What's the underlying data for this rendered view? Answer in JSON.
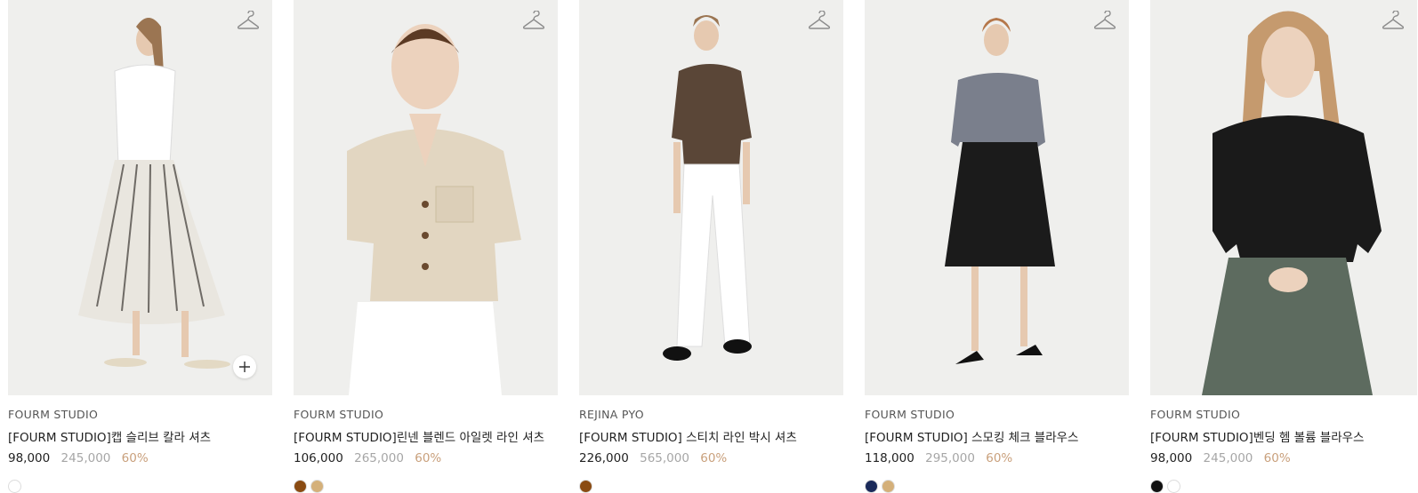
{
  "products": [
    {
      "brand": "FOURM STUDIO",
      "name": "[FOURM STUDIO]캡 슬리브 칼라 셔츠",
      "price": "98,000",
      "original_price": "245,000",
      "discount": "60%",
      "swatches": [
        "#ffffff"
      ]
    },
    {
      "brand": "FOURM STUDIO",
      "name": "[FOURM STUDIO]린넨 블렌드 아일렛 라인 셔츠",
      "price": "106,000",
      "original_price": "265,000",
      "discount": "60%",
      "swatches": [
        "#8a4b12",
        "#d4b07a"
      ]
    },
    {
      "brand": "REJINA PYO",
      "name": "[FOURM STUDIO] 스티치 라인 박시 셔츠",
      "price": "226,000",
      "original_price": "565,000",
      "discount": "60%",
      "swatches": [
        "#8a4b12"
      ]
    },
    {
      "brand": "FOURM STUDIO",
      "name": "[FOURM STUDIO] 스모킹 체크 블라우스",
      "price": "118,000",
      "original_price": "295,000",
      "discount": "60%",
      "swatches": [
        "#1b2a5a",
        "#d4b07a"
      ]
    },
    {
      "brand": "FOURM STUDIO",
      "name": "[FOURM STUDIO]벤딩 헴 볼륨 블라우스",
      "price": "98,000",
      "original_price": "245,000",
      "discount": "60%",
      "swatches": [
        "#111111",
        "#ffffff"
      ]
    }
  ],
  "icons": {
    "wishlist": "hanger-icon",
    "quick_add": "plus-icon"
  },
  "colors": {
    "discount": "#c9a07c",
    "original_price": "#a6a6a6",
    "image_bg": "#efefed"
  }
}
